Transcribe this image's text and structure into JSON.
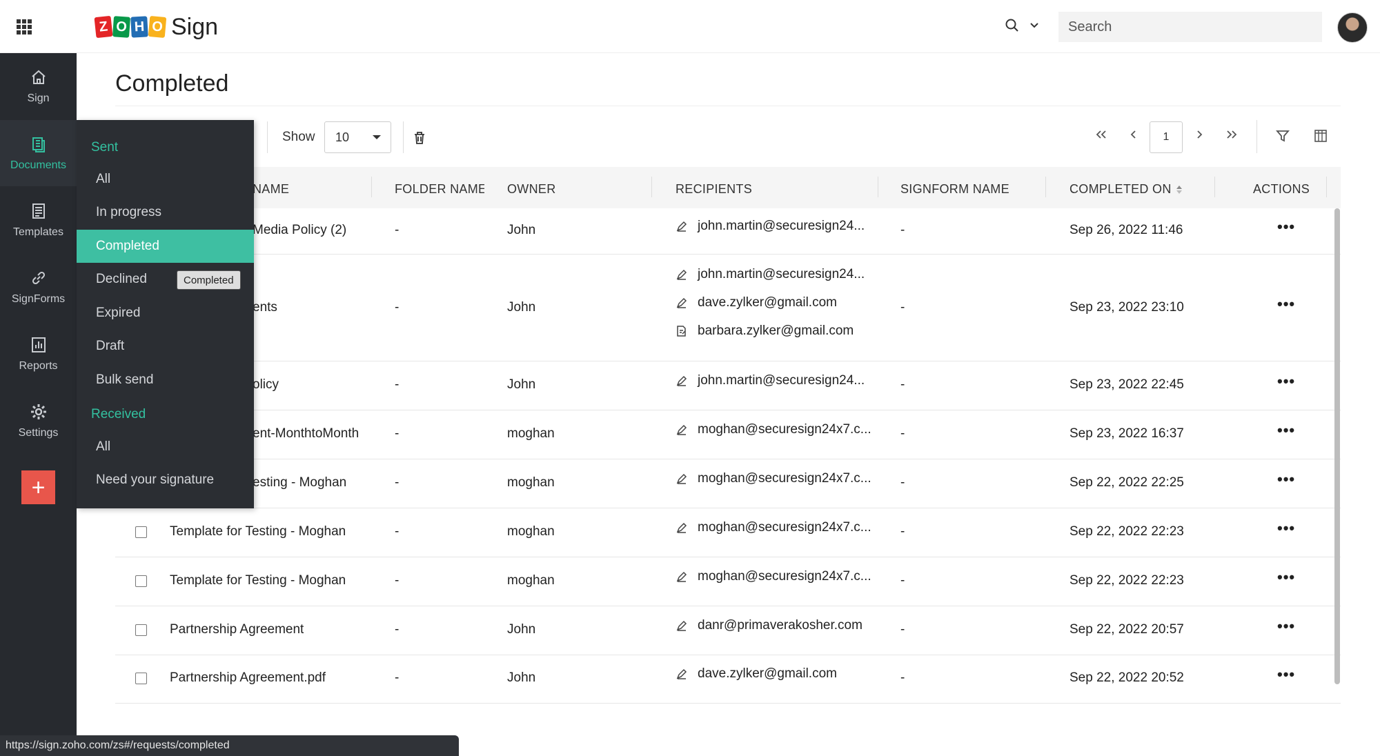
{
  "app": {
    "brand_letters": [
      "Z",
      "O",
      "H",
      "O"
    ],
    "product": "Sign",
    "accent": "#3ebfa2",
    "sidebar_bg": "#272a2f",
    "add_color": "#e8564b"
  },
  "header": {
    "search_placeholder": "Search"
  },
  "leftnav": {
    "items": [
      {
        "label": "Sign",
        "icon": "home-icon"
      },
      {
        "label": "Documents",
        "icon": "documents-icon",
        "active": true
      },
      {
        "label": "Templates",
        "icon": "templates-icon"
      },
      {
        "label": "SignForms",
        "icon": "link-icon"
      },
      {
        "label": "Reports",
        "icon": "reports-icon"
      },
      {
        "label": "Settings",
        "icon": "gear-icon"
      }
    ],
    "add_label": "+"
  },
  "page": {
    "title": "Completed"
  },
  "toolbar": {
    "show_label": "Show",
    "show_value": "10",
    "page_number": "1"
  },
  "table": {
    "headers": {
      "name": "NAME",
      "folder": "FOLDER NAME",
      "owner": "OWNER",
      "recipients": "RECIPIENTS",
      "signform": "SIGNFORM NAME",
      "completed_on": "COMPLETED ON",
      "actions": "ACTIONS"
    },
    "rows": [
      {
        "name": "Media Policy (2)",
        "folder": "-",
        "owner": "John",
        "recipients": [
          "john.martin@securesign24..."
        ],
        "signform": "-",
        "completed_on": "Sep 26, 2022 11:46"
      },
      {
        "name": "ents",
        "folder": "-",
        "owner": "John",
        "recipients": [
          "john.martin@securesign24...",
          "dave.zylker@gmail.com",
          "barbara.zylker@gmail.com"
        ],
        "signform": "-",
        "completed_on": "Sep 23, 2022 23:10"
      },
      {
        "name": "olicy",
        "folder": "-",
        "owner": "John",
        "recipients": [
          "john.martin@securesign24..."
        ],
        "signform": "-",
        "completed_on": "Sep 23, 2022 22:45"
      },
      {
        "name": "ent-MonthtoMonth",
        "folder": "-",
        "owner": "moghan",
        "recipients": [
          "moghan@securesign24x7.c..."
        ],
        "signform": "-",
        "completed_on": "Sep 23, 2022 16:37"
      },
      {
        "name": "esting - Moghan",
        "folder": "-",
        "owner": "moghan",
        "recipients": [
          "moghan@securesign24x7.c..."
        ],
        "signform": "-",
        "completed_on": "Sep 22, 2022 22:25"
      },
      {
        "name": "Template for Testing - Moghan",
        "folder": "-",
        "owner": "moghan",
        "recipients": [
          "moghan@securesign24x7.c..."
        ],
        "signform": "-",
        "completed_on": "Sep 22, 2022 22:23"
      },
      {
        "name": "Template for Testing - Moghan",
        "folder": "-",
        "owner": "moghan",
        "recipients": [
          "moghan@securesign24x7.c..."
        ],
        "signform": "-",
        "completed_on": "Sep 22, 2022 22:23"
      },
      {
        "name": "Partnership Agreement",
        "folder": "-",
        "owner": "John",
        "recipients": [
          "danr@primaverakosher.com"
        ],
        "signform": "-",
        "completed_on": "Sep 22, 2022 20:57"
      },
      {
        "name": "Partnership Agreement.pdf",
        "folder": "-",
        "owner": "John",
        "recipients": [
          "dave.zylker@gmail.com"
        ],
        "signform": "-",
        "completed_on": "Sep 22, 2022 20:52"
      }
    ]
  },
  "dropdown": {
    "sent_heading": "Sent",
    "sent_items": [
      "All",
      "In progress",
      "Completed",
      "Declined",
      "Expired",
      "Draft",
      "Bulk send"
    ],
    "received_heading": "Received",
    "received_items": [
      "All",
      "Need your signature"
    ],
    "active": "Completed",
    "tooltip": "Completed"
  },
  "status_bar": {
    "url": "https://sign.zoho.com/zs#/requests/completed"
  }
}
